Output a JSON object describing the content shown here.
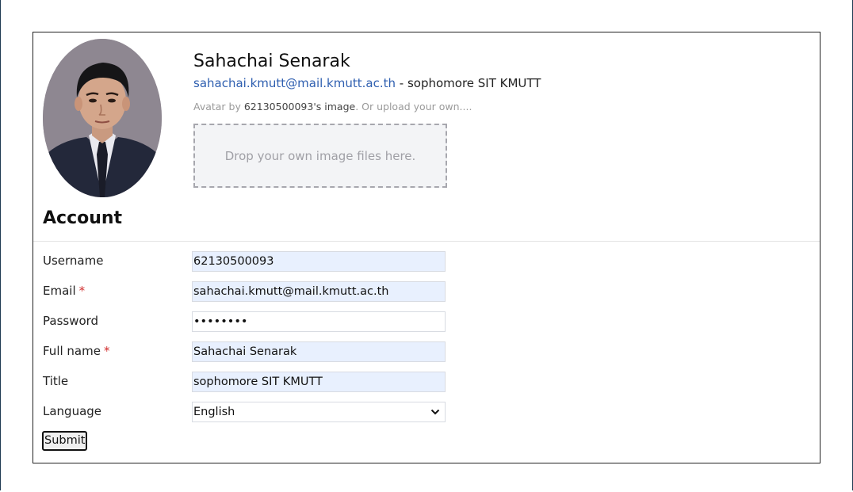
{
  "profile": {
    "name": "Sahachai Senarak",
    "email": "sahachai.kmutt@mail.kmutt.ac.th",
    "title_separator": " - ",
    "title": "sophomore SIT KMUTT",
    "avatar_note_prefix": "Avatar by ",
    "avatar_note_owner": "62130500093's image",
    "avatar_note_suffix": ". Or upload your own....",
    "dropzone_text": "Drop your own image files here."
  },
  "account": {
    "heading": "Account",
    "required_marker": "*",
    "fields": {
      "username": {
        "label": "Username",
        "value": "62130500093"
      },
      "email": {
        "label": "Email",
        "value": "sahachai.kmutt@mail.kmutt.ac.th"
      },
      "password": {
        "label": "Password",
        "value": "••••••••"
      },
      "fullname": {
        "label": "Full name",
        "value": "Sahachai Senarak"
      },
      "title": {
        "label": "Title",
        "value": "sophomore SIT KMUTT"
      },
      "language": {
        "label": "Language",
        "value": "English"
      }
    },
    "submit_label": "Submit"
  },
  "colors": {
    "link": "#2f5fb0",
    "required": "#d12d2d",
    "autofill": "#e8f0fe"
  },
  "icons": {
    "select_arrow": "chevron-down-icon"
  }
}
